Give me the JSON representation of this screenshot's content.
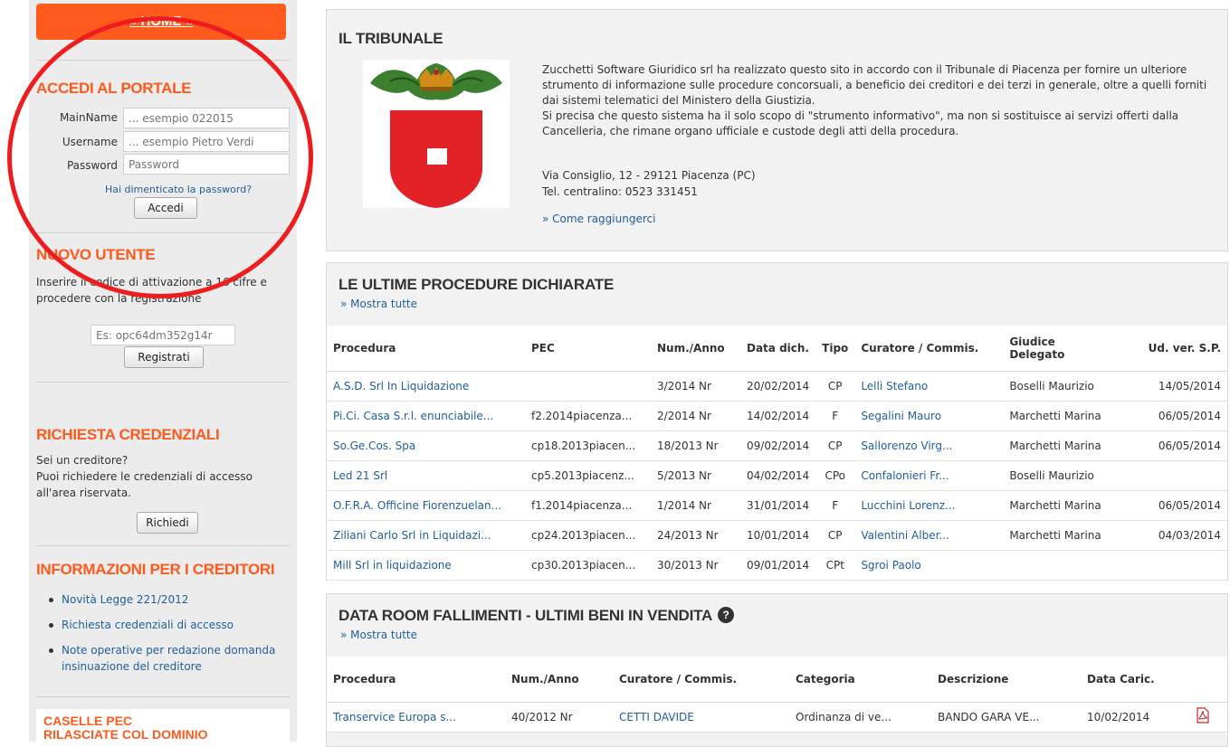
{
  "sidebar": {
    "home_label": "» HOME «",
    "login": {
      "title": "ACCEDI AL PORTALE",
      "mainname_label": "MainName",
      "mainname_placeholder": "... esempio 022015",
      "username_label": "Username",
      "username_placeholder": "... esempio Pietro Verdi",
      "password_label": "Password",
      "password_placeholder": "Password",
      "forgot_link": "Hai dimenticato la password?",
      "submit_label": "Accedi"
    },
    "new_user": {
      "title": "NUOVO UTENTE",
      "text": "Inserire il codice di attivazione a 16 cifre e procedere con la registrazione",
      "code_placeholder": "Es: opc64dm352g14r",
      "submit_label": "Registrati"
    },
    "credentials": {
      "title": "RICHIESTA CREDENZIALI",
      "line1": "Sei un creditore?",
      "line2": "Puoi richiedere le credenziali di accesso all'area riservata.",
      "button_label": "Richiedi"
    },
    "creditors_info": {
      "title": "INFORMAZIONI PER I CREDITORI",
      "items": [
        "Novità Legge 221/2012",
        "Richiesta credenziali di accesso",
        "Note operative per redazione domanda insinuazione del creditore"
      ]
    },
    "pec": {
      "title_line1": "CASELLE PEC",
      "title_line2": "RILASCIATE COL DOMINIO"
    }
  },
  "tribunale": {
    "title": "IL TRIBUNALE",
    "p1": "Zucchetti Software Giuridico srl ha realizzato questo sito in accordo con il Tribunale di Piacenza per fornire un ulteriore strumento di informazione sulle procedure concorsuali, a beneficio dei creditori e dei terzi in generale, oltre a quelli forniti dai sistemi telematici del Ministero della Giustizia.",
    "p2": "Si precisa che questo sistema ha il solo scopo di \"strumento informativo\", ma non si sostituisce ai servizi offerti dalla Cancelleria, che rimane organo ufficiale e custode degli atti della procedura.",
    "address": "Via Consiglio, 12 - 29121 Piacenza (PC)",
    "phone": "Tel. centralino: 0523 331451",
    "directions_link": "» Come raggiungerci"
  },
  "procedures": {
    "title": "LE ULTIME PROCEDURE DICHIARATE",
    "show_all": "» Mostra tutte",
    "headers": [
      "Procedura",
      "PEC",
      "Num./Anno",
      "Data dich.",
      "Tipo",
      "Curatore / Commis.",
      "Giudice Delegato",
      "Ud. ver. S.P."
    ],
    "rows": [
      [
        "A.S.D. Srl In Liquidazione",
        "",
        "3/2014 Nr",
        "20/02/2014",
        "CP",
        "Lelli Stefano",
        "Boselli Maurizio",
        "14/05/2014"
      ],
      [
        "Pi.Ci. Casa S.r.l. enunciabile...",
        "f2.2014piacenza...",
        "2/2014 Nr",
        "14/02/2014",
        "F",
        "Segalini Mauro",
        "Marchetti Marina",
        "06/05/2014"
      ],
      [
        "So.Ge.Cos. Spa",
        "cp18.2013piacen...",
        "18/2013 Nr",
        "09/02/2014",
        "CP",
        "Sallorenzo Virg...",
        "Marchetti Marina",
        "06/05/2014"
      ],
      [
        "Led 21 Srl",
        "cp5.2013piacenz...",
        "5/2013 Nr",
        "04/02/2014",
        "CPo",
        "Confalonieri Fr...",
        "Boselli Maurizio",
        ""
      ],
      [
        "O.F.R.A. Officine Fiorenzuelan...",
        "f1.2014piacenza...",
        "1/2014 Nr",
        "31/01/2014",
        "F",
        "Lucchini Lorenz...",
        "Marchetti Marina",
        "06/05/2014"
      ],
      [
        "Ziliani Carlo Srl in Liquidazi...",
        "cp24.2013piacen...",
        "24/2013 Nr",
        "10/01/2014",
        "CP",
        "Valentini Alber...",
        "Marchetti Marina",
        "04/03/2014"
      ],
      [
        "Mill Srl in liquidazione",
        "cp30.2013piacen...",
        "30/2013 Nr",
        "09/01/2014",
        "CPt",
        "Sgroi Paolo",
        "",
        ""
      ]
    ]
  },
  "dataroom": {
    "title": "DATA ROOM FALLIMENTI - ULTIMI BENI IN VENDITA",
    "help_glyph": "?",
    "show_all": "» Mostra tutte",
    "headers": [
      "Procedura",
      "Num./Anno",
      "Curatore / Commis.",
      "Categoria",
      "Descrizione",
      "Data Caric."
    ],
    "rows": [
      [
        "Transervice Europa s...",
        "40/2012 Nr",
        "CETTI DAVIDE",
        "Ordinanza di ve...",
        "BANDO GARA VE...",
        "10/02/2014"
      ]
    ]
  },
  "colors": {
    "accent": "#ff5a1e",
    "link": "#1f5e9e",
    "highlight": "#ee1c1c"
  }
}
